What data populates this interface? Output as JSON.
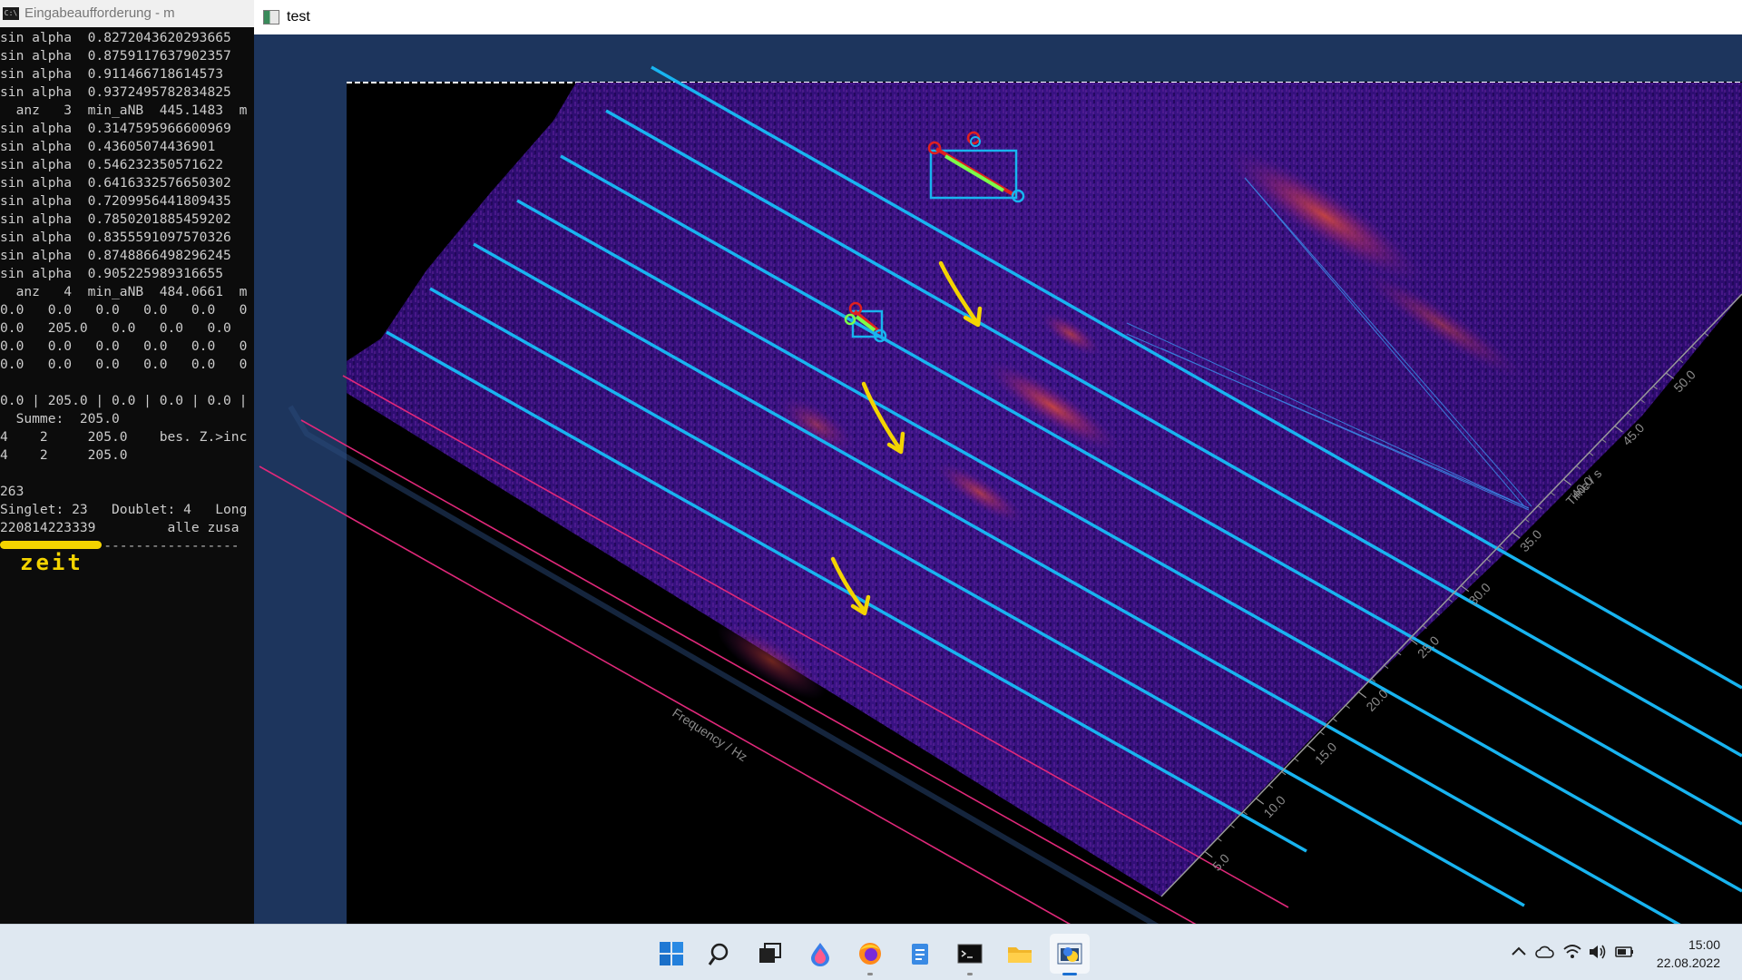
{
  "console": {
    "title": "Eingabeaufforderung - m",
    "lines": [
      "sin alpha  0.8272043620293665",
      "sin alpha  0.8759117637902357",
      "sin alpha  0.911466718614573",
      "sin alpha  0.9372495782834825",
      "  anz   3  min_aNB  445.1483  m",
      "sin alpha  0.3147595966600969",
      "sin alpha  0.43605074436901",
      "sin alpha  0.546232350571622",
      "sin alpha  0.6416332576650302",
      "sin alpha  0.7209956441809435",
      "sin alpha  0.7850201885459202",
      "sin alpha  0.8355591097570326",
      "sin alpha  0.8748866498296245",
      "sin alpha  0.905225989316655",
      "  anz   4  min_aNB  484.0661  m",
      "0.0   0.0   0.0   0.0   0.0   0",
      "0.0   205.0   0.0   0.0   0.0",
      "0.0   0.0   0.0   0.0   0.0   0",
      "0.0   0.0   0.0   0.0   0.0   0",
      "",
      "0.0 | 205.0 | 0.0 | 0.0 | 0.0 |",
      "  Summe:  205.0",
      "4    2     205.0    bes. Z.>inc",
      "4    2     205.0",
      "",
      "263",
      "Singlet: 23   Doublet: 4   Long",
      "220814223339         alle zusa",
      "------------------------------"
    ],
    "annotation": "zeit"
  },
  "window": {
    "title": "test",
    "plot": {
      "freq_axis_label": "Frequency / Hz",
      "time_axis_label": "Time / s",
      "time_ticks": [
        "5.0",
        "10.0",
        "15.0",
        "20.0",
        "25.0",
        "30.0",
        "35.0",
        "40.0",
        "45.0",
        "50.0"
      ],
      "colors": {
        "background": "#000000",
        "frame": "#1d355d",
        "cyan_lines": "#18b4f0",
        "magenta_lines": "#e0287a",
        "annotation": "#f4d400"
      }
    }
  },
  "taskbar": {
    "apps": [
      {
        "name": "start-icon"
      },
      {
        "name": "search-icon"
      },
      {
        "name": "task-view-icon"
      },
      {
        "name": "paint-icon"
      },
      {
        "name": "firefox-icon"
      },
      {
        "name": "notepad-icon"
      },
      {
        "name": "terminal-icon"
      },
      {
        "name": "file-explorer-icon"
      },
      {
        "name": "python-app-icon"
      }
    ],
    "tray": {
      "time": "15:00",
      "date": "22.08.2022"
    }
  }
}
